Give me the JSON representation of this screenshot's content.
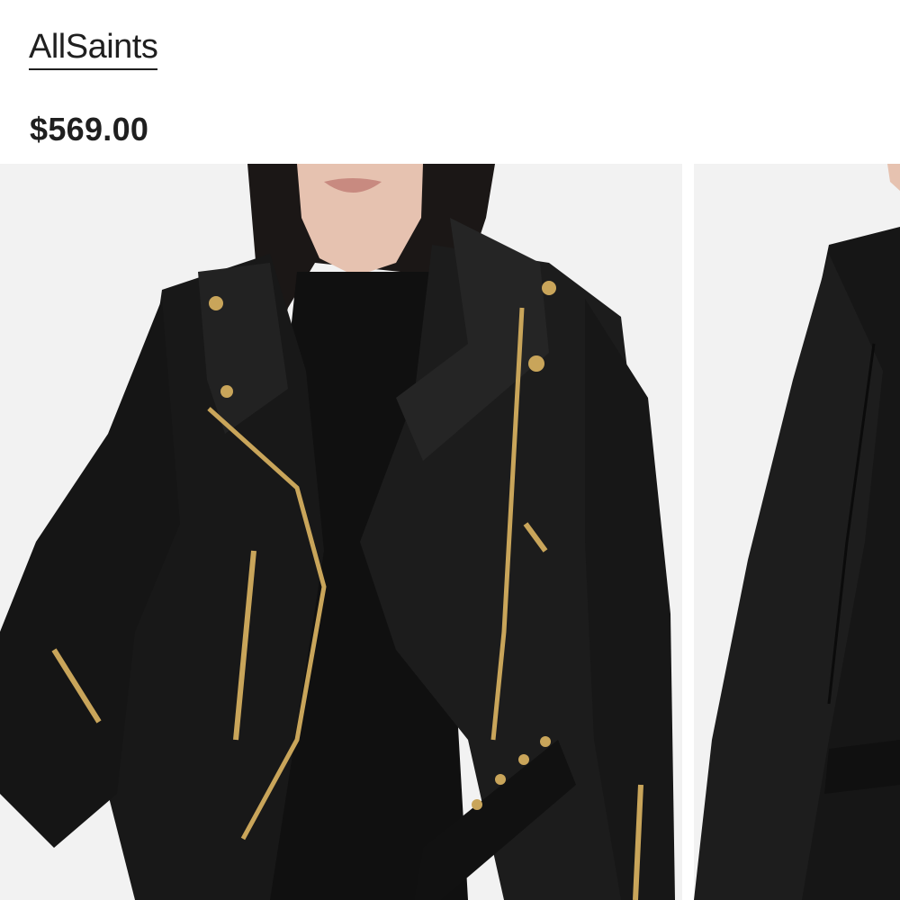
{
  "product": {
    "brand": "AllSaints",
    "price": "$569.00"
  },
  "gallery": {
    "images": [
      {
        "name": "product-image-front"
      },
      {
        "name": "product-image-side"
      }
    ]
  },
  "colors": {
    "text": "#1f1f1f",
    "image_background": "#f2f2f2",
    "leather": "#161616",
    "hardware_gold": "#c9a55a"
  }
}
